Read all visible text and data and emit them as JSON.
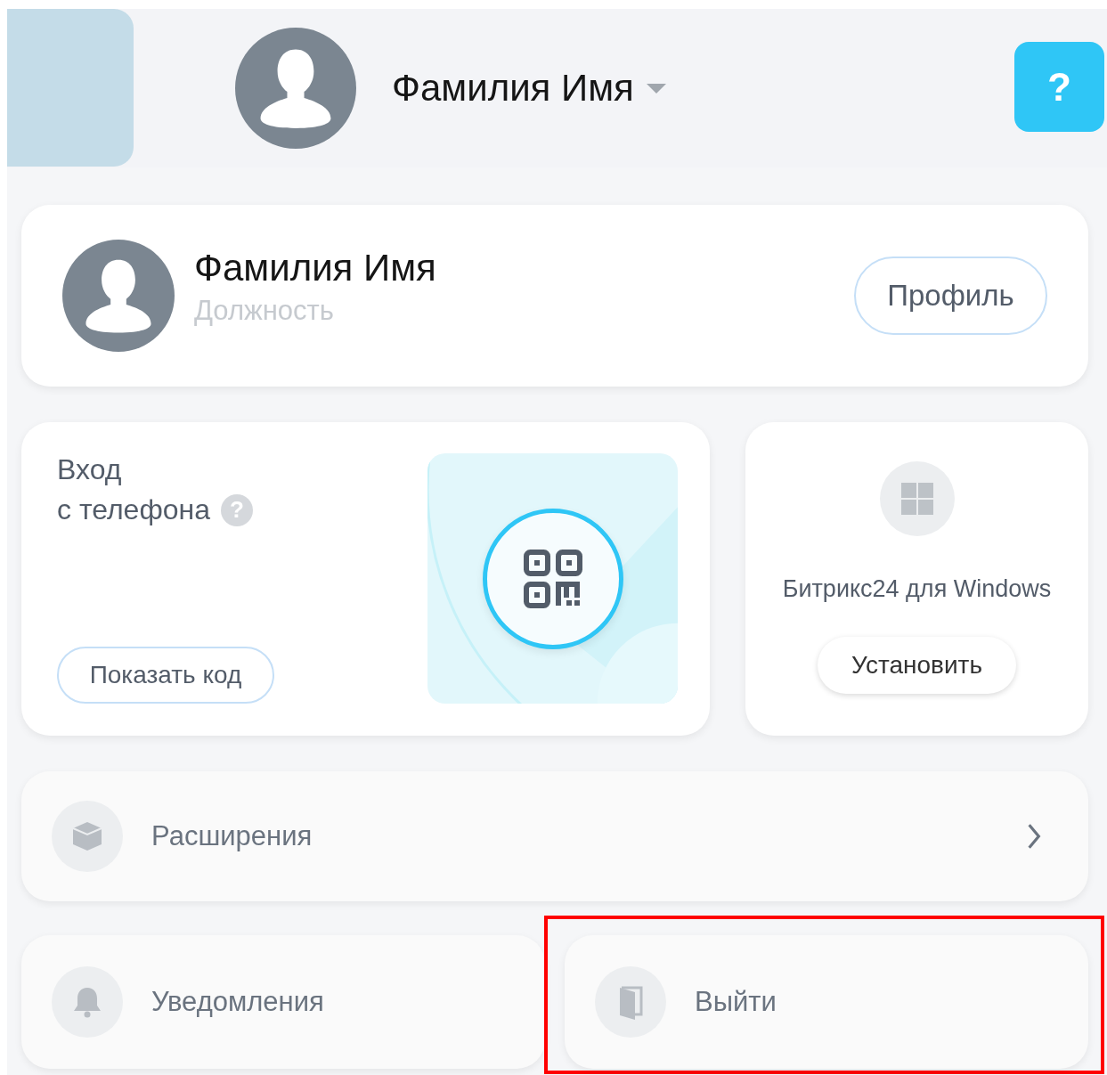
{
  "header": {
    "user_name": "Фамилия Имя",
    "help": "?"
  },
  "profile": {
    "name": "Фамилия Имя",
    "position": "Должность",
    "button": "Профиль"
  },
  "phone_login": {
    "title": "Вход",
    "subtitle": "с телефона",
    "hint": "?",
    "button": "Показать код"
  },
  "desktop_app": {
    "title": "Битрикс24 для Windows",
    "button": "Установить"
  },
  "menu": [
    {
      "kind": "wide",
      "label": "Расширения",
      "highlighted": false
    },
    {
      "kind": "half",
      "label": "Уведомления",
      "highlighted": false
    },
    {
      "kind": "half",
      "label": "Выйти",
      "highlighted": true
    }
  ]
}
